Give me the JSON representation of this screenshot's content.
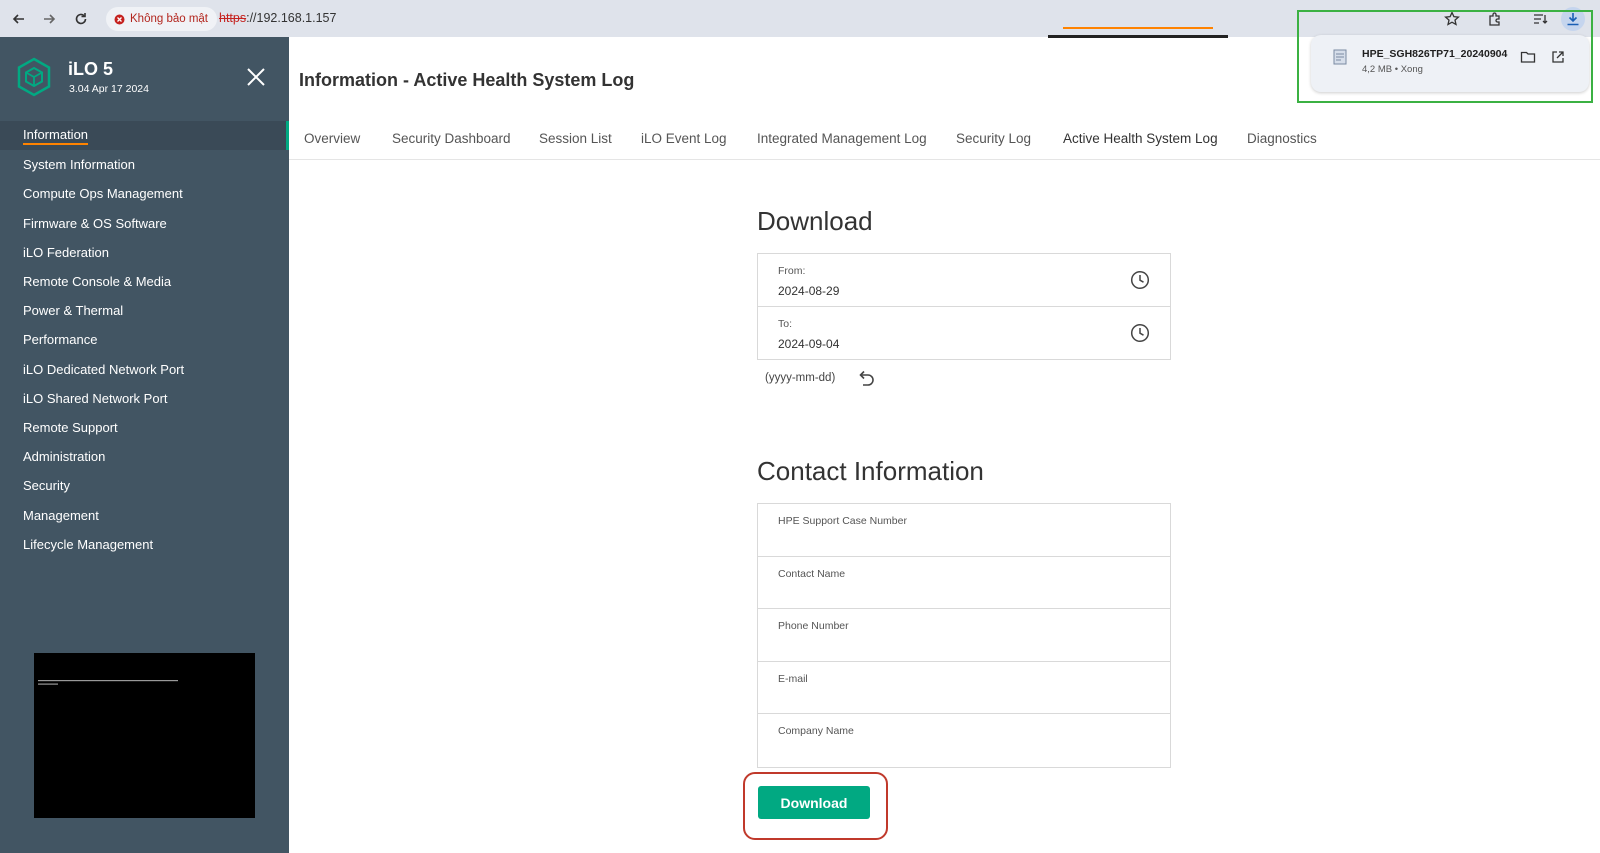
{
  "browser": {
    "security_label": "Không bảo mật",
    "url_protocol": "https",
    "url_rest": "://192.168.1.157"
  },
  "download_popup": {
    "file_name": "HPE_SGH826TP71_20240904",
    "file_meta": "4,2 MB • Xong"
  },
  "sidebar": {
    "app_name": "iLO 5",
    "version": "3.04 Apr 17 2024",
    "items": [
      {
        "label": "Information",
        "active": true
      },
      {
        "label": "System Information"
      },
      {
        "label": "Compute Ops Management"
      },
      {
        "label": "Firmware & OS Software"
      },
      {
        "label": "iLO Federation"
      },
      {
        "label": "Remote Console & Media"
      },
      {
        "label": "Power & Thermal"
      },
      {
        "label": "Performance"
      },
      {
        "label": "iLO Dedicated Network Port"
      },
      {
        "label": "iLO Shared Network Port"
      },
      {
        "label": "Remote Support"
      },
      {
        "label": "Administration"
      },
      {
        "label": "Security"
      },
      {
        "label": "Management"
      },
      {
        "label": "Lifecycle Management"
      }
    ]
  },
  "page": {
    "title": "Information - Active Health System Log"
  },
  "tabs": [
    {
      "label": "Overview"
    },
    {
      "label": "Security Dashboard"
    },
    {
      "label": "Session List"
    },
    {
      "label": "iLO Event Log"
    },
    {
      "label": "Integrated Management Log"
    },
    {
      "label": "Security Log"
    },
    {
      "label": "Active Health System Log",
      "active": true
    },
    {
      "label": "Diagnostics"
    }
  ],
  "download_section": {
    "title": "Download",
    "from_label": "From:",
    "from_value": "2024-08-29",
    "to_label": "To:",
    "to_value": "2024-09-04",
    "date_format": "(yyyy-mm-dd)"
  },
  "contact_section": {
    "title": "Contact Information",
    "fields": [
      {
        "label": "HPE Support Case Number"
      },
      {
        "label": "Contact Name"
      },
      {
        "label": "Phone Number"
      },
      {
        "label": "E-mail"
      },
      {
        "label": "Company Name"
      }
    ]
  },
  "actions": {
    "download_label": "Download"
  },
  "colors": {
    "sidebar_bg": "#425563",
    "accent_green": "#01a982",
    "accent_orange": "#ff8300"
  }
}
